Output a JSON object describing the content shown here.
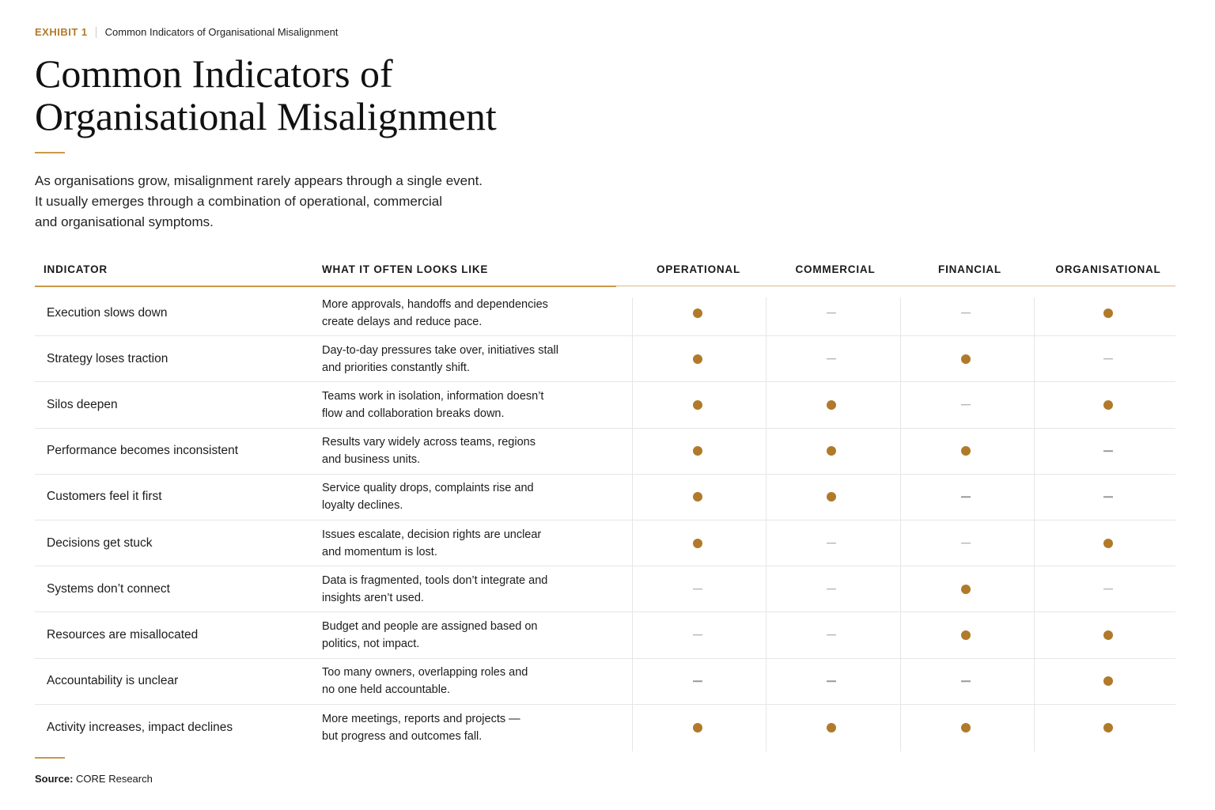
{
  "eyebrow": {
    "exhibit": "EXHIBIT 1",
    "title": "Common Indicators of Organisational Misalignment"
  },
  "title": {
    "line1": "Common Indicators of",
    "line2": "Organisational Misalignment"
  },
  "intro": {
    "line1": "As organisations grow, misalignment rarely appears through a single event.",
    "line2": "It usually emerges through a combination of operational, commercial",
    "line3": "and organisational symptoms."
  },
  "table": {
    "headers": {
      "indicator": "INDICATOR",
      "looks": "WHAT IT OFTEN LOOKS LIKE",
      "operational": "OPERATIONAL",
      "commercial": "COMMERCIAL",
      "financial": "FINANCIAL",
      "organisational": "ORGANISATIONAL"
    },
    "rows": [
      {
        "indicator": "Execution slows down",
        "look1": "More approvals, handoffs and dependencies",
        "look2": "create delays and reduce pace.",
        "marks": [
          true,
          false,
          false,
          true
        ]
      },
      {
        "indicator": "Strategy loses traction",
        "look1": "Day-to-day pressures take over, initiatives stall",
        "look2": "and priorities constantly shift.",
        "marks": [
          true,
          false,
          true,
          false
        ]
      },
      {
        "indicator": "Silos deepen",
        "look1": "Teams work in isolation, information doesn’t",
        "look2": "flow and collaboration breaks down.",
        "marks": [
          true,
          true,
          false,
          true
        ]
      },
      {
        "indicator": "Performance becomes inconsistent",
        "look1": "Results vary widely across teams, regions",
        "look2": "and business units.",
        "marks": [
          true,
          true,
          true,
          false
        ]
      },
      {
        "indicator": "Customers feel it first",
        "look1": "Service quality drops, complaints rise and",
        "look2": "loyalty declines.",
        "marks": [
          true,
          true,
          false,
          false
        ]
      },
      {
        "indicator": "Decisions get stuck",
        "look1": "Issues escalate, decision rights are unclear",
        "look2": "and momentum is lost.",
        "marks": [
          true,
          false,
          false,
          true
        ]
      },
      {
        "indicator": "Systems don’t connect",
        "look1": "Data is fragmented, tools don’t integrate and",
        "look2": "insights aren’t used.",
        "marks": [
          false,
          false,
          true,
          false
        ]
      },
      {
        "indicator": "Resources are misallocated",
        "look1": "Budget and people are assigned based on",
        "look2": "politics, not impact.",
        "marks": [
          false,
          false,
          true,
          true
        ]
      },
      {
        "indicator": "Accountability is unclear",
        "look1": "Too many owners, overlapping roles and",
        "look2": "no one held accountable.",
        "marks": [
          false,
          false,
          false,
          true
        ]
      },
      {
        "indicator": "Activity increases, impact declines",
        "look1": "More meetings, reports and projects —",
        "look2": "but progress and outcomes fall.",
        "marks": [
          true,
          true,
          true,
          true
        ]
      }
    ]
  },
  "source": {
    "label": "Source:",
    "text": "CORE Research"
  },
  "colors": {
    "accent": "#b07a2a",
    "rule": "#c9994a",
    "dash": "#9a9a9a"
  },
  "icons": {
    "present": "dot-icon",
    "absent": "dash-icon"
  }
}
